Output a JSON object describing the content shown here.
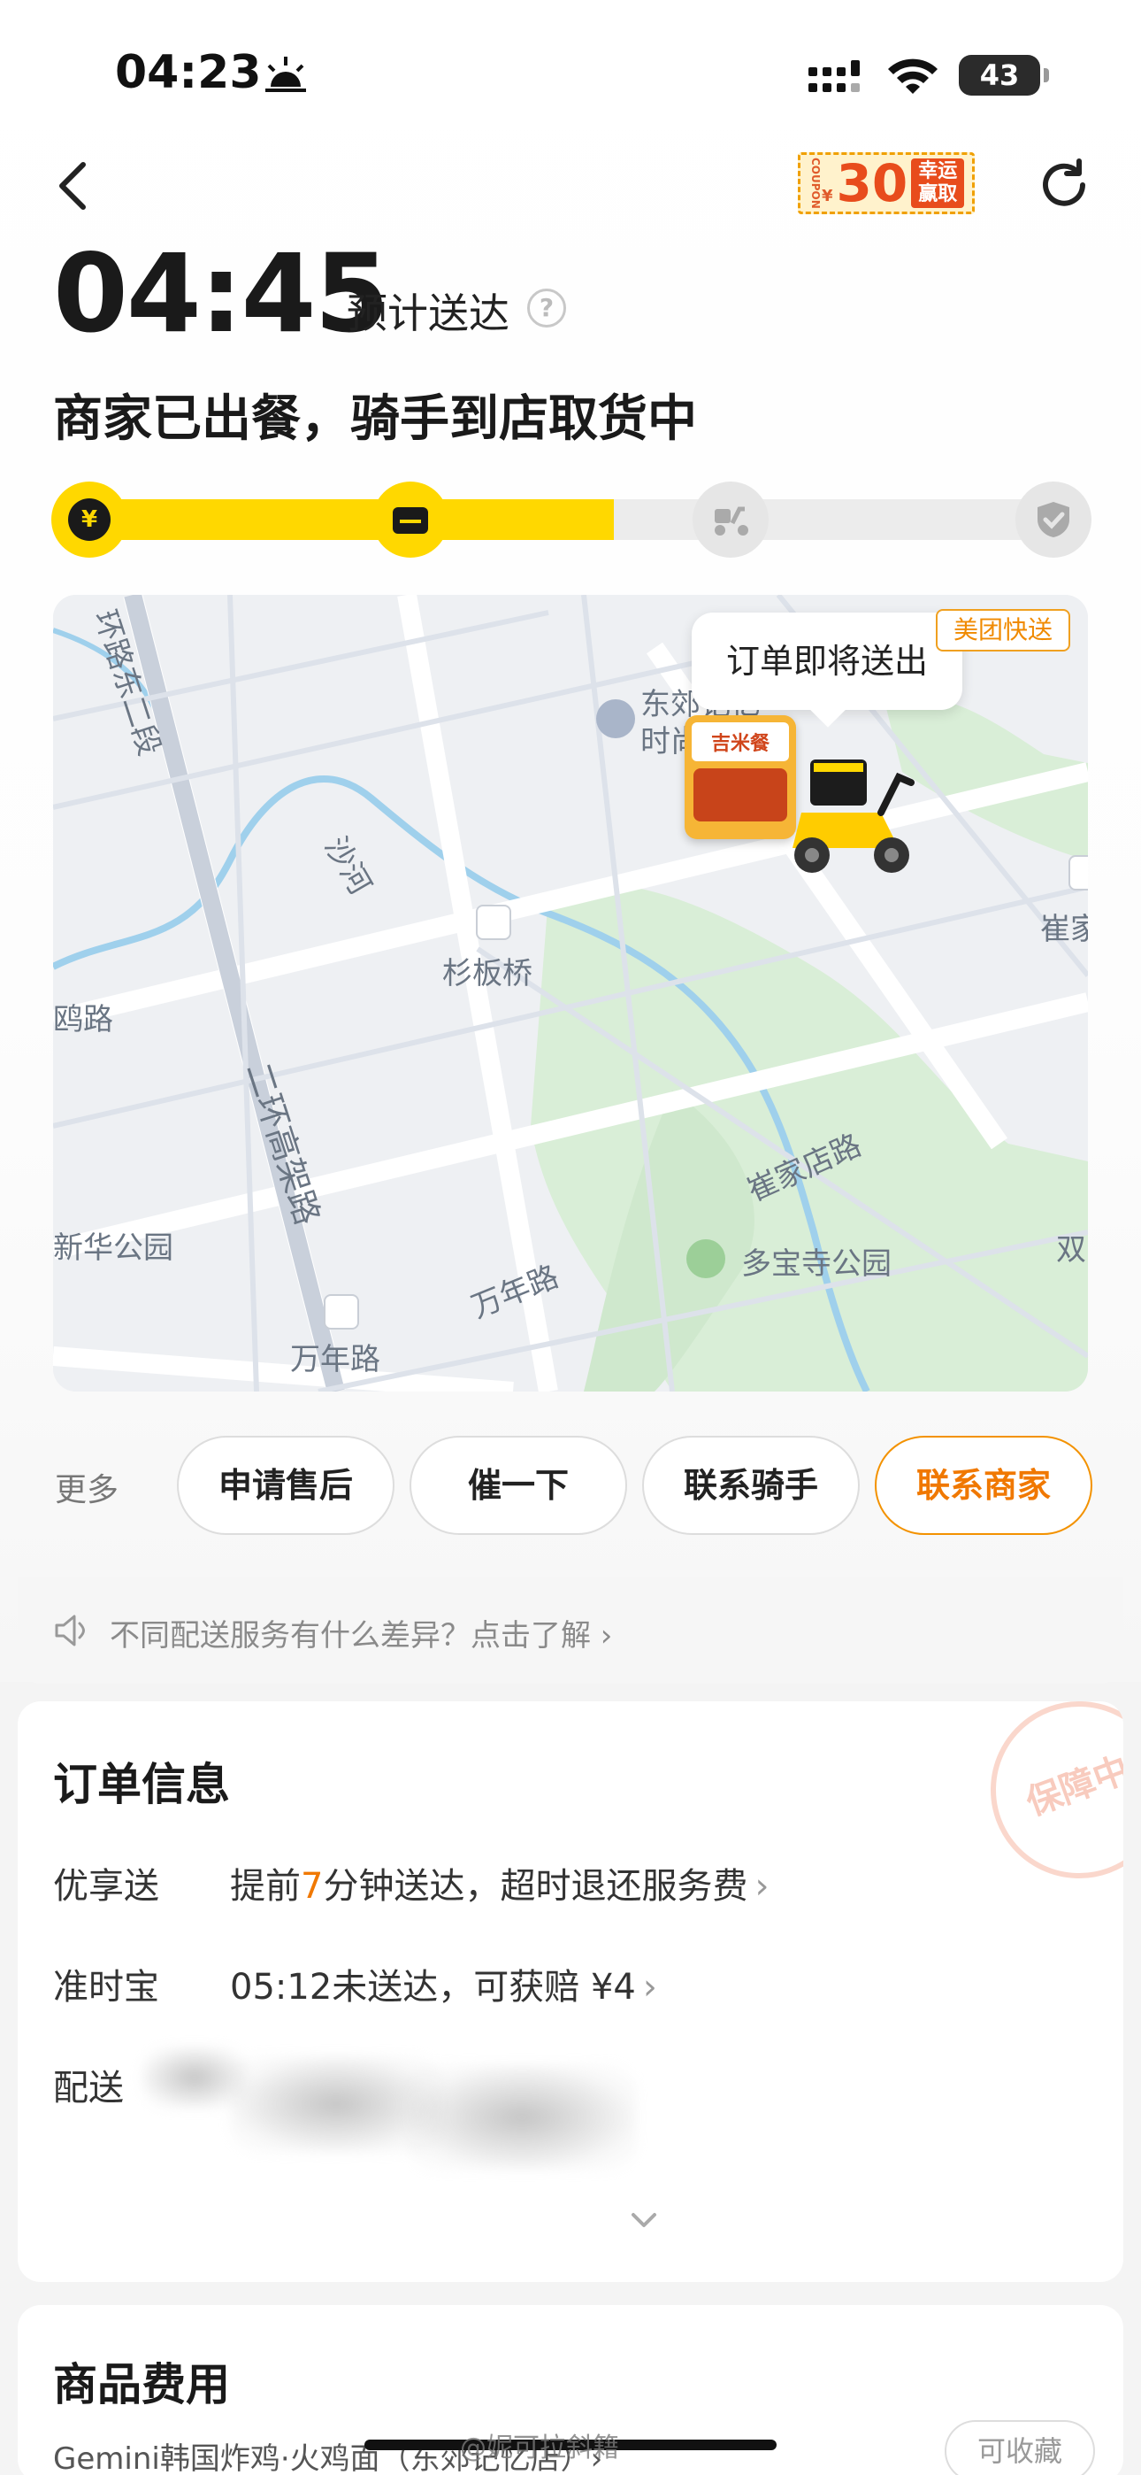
{
  "status_bar": {
    "time": "04:23",
    "battery": "43"
  },
  "header": {
    "coupon_side": "COUPON",
    "coupon_yen": "¥",
    "coupon_amount": "30",
    "coupon_text": "幸运赢取"
  },
  "eta": {
    "time": "04:45",
    "label": "预计送达",
    "help": "?"
  },
  "order_status": "商家已出餐，骑手到店取货中",
  "progress": {
    "fraction": 0.54,
    "steps": [
      "paid",
      "merchant",
      "delivering",
      "done"
    ]
  },
  "map": {
    "bubble": "订单即将送出",
    "badge": "美团快送",
    "store_brand": "吉米餐",
    "labels": [
      "环路东二段",
      "沙河",
      "二环高架路",
      "杉板桥",
      "鸥路",
      "东郊记忆",
      "时尚",
      "崔家店路",
      "崔家",
      "新华公园",
      "多宝寺公园",
      "万年路",
      "万年路",
      "双"
    ]
  },
  "actions": {
    "more": "更多",
    "buttons": [
      "申请售后",
      "催一下",
      "联系骑手",
      "联系商家"
    ]
  },
  "tip": "不同配送服务有什么差异？点击了解 ›",
  "order_info": {
    "title": "订单信息",
    "stamp": "保障中",
    "rows": [
      {
        "label": "优享送",
        "pre": "提前",
        "highlight": "7",
        "post": "分钟送达，超时退还服务费"
      },
      {
        "label": "准时宝",
        "value": "05:12未送达，可获赔 ¥4"
      },
      {
        "label": "配送"
      }
    ]
  },
  "fees": {
    "title": "商品费用",
    "item": "Gemini韩国炸鸡·火鸡面（东郊记忆店）›",
    "fav": "可收藏"
  },
  "watermark": "@妮可拉斜籍",
  "colors": {
    "accent": "#ffd800",
    "orange": "#f07800",
    "brand_tag": "#f08a00"
  }
}
